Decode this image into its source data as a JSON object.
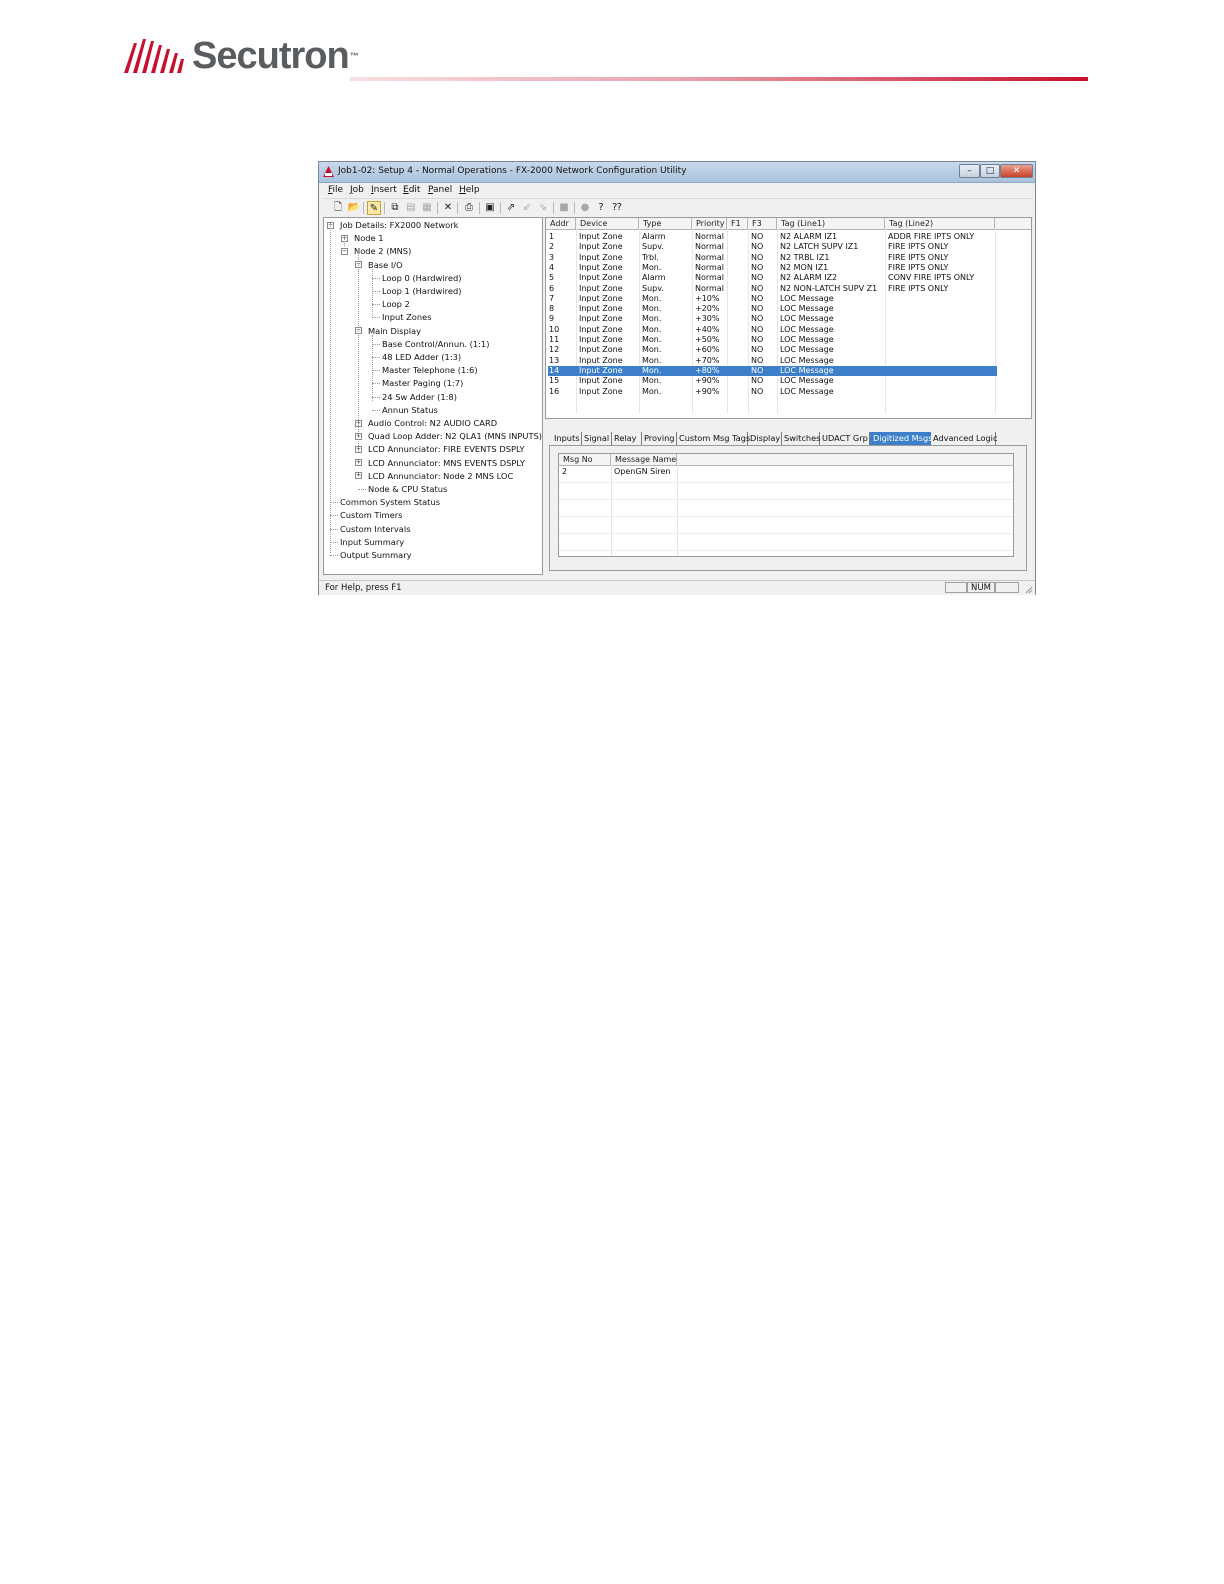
{
  "brand": {
    "name": "Secutron",
    "tm": "™",
    "accent": "#c8102e",
    "text_color": "#5a5d60"
  },
  "window": {
    "title": "Job1-02: Setup 4 - Normal Operations - FX-2000 Network Configuration Utility",
    "controls": {
      "minimize": "–",
      "maximize": "□",
      "close": "✕"
    }
  },
  "menu": [
    {
      "u": "F",
      "rest": "ile"
    },
    {
      "u": "J",
      "rest": "ob"
    },
    {
      "u": "I",
      "rest": "nsert"
    },
    {
      "u": "E",
      "rest": "dit"
    },
    {
      "u": "P",
      "rest": "anel"
    },
    {
      "u": "H",
      "rest": "elp"
    }
  ],
  "toolbar_icons": [
    "new-icon",
    "open-icon",
    "edit-pencil-icon",
    "copy-icon",
    "paste-icon",
    "paste-special-icon",
    "delete-icon",
    "print-icon",
    "print-preview-icon",
    "upload-icon",
    "download-icon",
    "download-alt-icon",
    "stop-icon",
    "record-icon",
    "help-icon",
    "context-help-icon"
  ],
  "tree": [
    {
      "label": "Job Details: FX2000 Network",
      "box": "−"
    },
    {
      "label": "Node 1",
      "box": "+"
    },
    {
      "label": "Node 2 (MNS)",
      "box": "−"
    },
    {
      "label": "Base I/O",
      "box": "−"
    },
    {
      "label": "Loop 0  (Hardwired)",
      "box": ""
    },
    {
      "label": "Loop 1  (Hardwired)",
      "box": ""
    },
    {
      "label": "Loop 2",
      "box": ""
    },
    {
      "label": "Input Zones",
      "box": ""
    },
    {
      "label": "Main Display",
      "box": "−"
    },
    {
      "label": "Base Control/Annun. (1:1)",
      "box": ""
    },
    {
      "label": "48 LED Adder (1:3)",
      "box": ""
    },
    {
      "label": "Master Telephone (1:6)",
      "box": ""
    },
    {
      "label": "Master Paging (1:7)",
      "box": ""
    },
    {
      "label": "24 Sw Adder (1:8)",
      "box": ""
    },
    {
      "label": "Annun Status",
      "box": ""
    },
    {
      "label": "Audio Control: N2 AUDIO CARD",
      "box": "+"
    },
    {
      "label": "Quad Loop Adder: N2 QLA1 (MNS INPUTS)",
      "box": "+"
    },
    {
      "label": "LCD Annunciator: FIRE EVENTS DSPLY",
      "box": "+"
    },
    {
      "label": "LCD Annunciator: MNS EVENTS DSPLY",
      "box": "+"
    },
    {
      "label": "LCD Annunciator: Node 2 MNS LOC",
      "box": "+"
    },
    {
      "label": "Node & CPU Status",
      "box": ""
    },
    {
      "label": "Common System Status",
      "box": ""
    },
    {
      "label": "Custom Timers",
      "box": ""
    },
    {
      "label": "Custom Intervals",
      "box": ""
    },
    {
      "label": "Input Summary",
      "box": ""
    },
    {
      "label": "Output Summary",
      "box": ""
    }
  ],
  "grid": {
    "columns": [
      "Addr",
      "Device",
      "Type",
      "Priority",
      "F1",
      "F3",
      "Tag (Line1)",
      "Tag (Line2)"
    ],
    "selected_row": 14,
    "rows": [
      [
        "1",
        "Input Zone",
        "Alarm",
        "Normal",
        "",
        "NO",
        "N2 ALARM IZ1",
        "ADDR FIRE IPTS ONLY"
      ],
      [
        "2",
        "Input Zone",
        "Supv.",
        "Normal",
        "",
        "NO",
        "N2 LATCH SUPV IZ1",
        "FIRE IPTS ONLY"
      ],
      [
        "3",
        "Input Zone",
        "Trbl.",
        "Normal",
        "",
        "NO",
        "N2 TRBL IZ1",
        "FIRE IPTS ONLY"
      ],
      [
        "4",
        "Input Zone",
        "Mon.",
        "Normal",
        "",
        "NO",
        "N2 MON IZ1",
        "FIRE IPTS ONLY"
      ],
      [
        "5",
        "Input Zone",
        "Alarm",
        "Normal",
        "",
        "NO",
        "N2 ALARM IZ2",
        "CONV FIRE IPTS ONLY"
      ],
      [
        "6",
        "Input Zone",
        "Supv.",
        "Normal",
        "",
        "NO",
        "N2 NON-LATCH SUPV Z1",
        "FIRE IPTS ONLY"
      ],
      [
        "7",
        "Input Zone",
        "Mon.",
        "+10%",
        "",
        "NO",
        "LOC Message",
        ""
      ],
      [
        "8",
        "Input Zone",
        "Mon.",
        "+20%",
        "",
        "NO",
        "LOC Message",
        ""
      ],
      [
        "9",
        "Input Zone",
        "Mon.",
        "+30%",
        "",
        "NO",
        "LOC Message",
        ""
      ],
      [
        "10",
        "Input Zone",
        "Mon.",
        "+40%",
        "",
        "NO",
        "LOC Message",
        ""
      ],
      [
        "11",
        "Input Zone",
        "Mon.",
        "+50%",
        "",
        "NO",
        "LOC Message",
        ""
      ],
      [
        "12",
        "Input Zone",
        "Mon.",
        "+60%",
        "",
        "NO",
        "LOC Message",
        ""
      ],
      [
        "13",
        "Input Zone",
        "Mon.",
        "+70%",
        "",
        "NO",
        "LOC Message",
        ""
      ],
      [
        "14",
        "Input Zone",
        "Mon.",
        "+80%",
        "",
        "NO",
        "LOC Message",
        ""
      ],
      [
        "15",
        "Input Zone",
        "Mon.",
        "+90%",
        "",
        "NO",
        "LOC Message",
        ""
      ],
      [
        "16",
        "Input Zone",
        "Mon.",
        "+90%",
        "",
        "NO",
        "LOC Message",
        ""
      ]
    ]
  },
  "tabs": {
    "items": [
      "Inputs",
      "Signal",
      "Relay",
      "Proving",
      "Custom Msg Tags",
      "Display",
      "Switches",
      "UDACT Grp",
      "Digitized Msgs",
      "Advanced Logic"
    ],
    "active": "Digitized Msgs"
  },
  "digitized_msgs": {
    "columns": [
      "Msg No",
      "Message Name"
    ],
    "rows": [
      [
        "2",
        "OpenGN Siren"
      ]
    ]
  },
  "status": {
    "help": "For Help, press F1",
    "num": "NUM"
  },
  "selection_color": "#3d7fc9"
}
